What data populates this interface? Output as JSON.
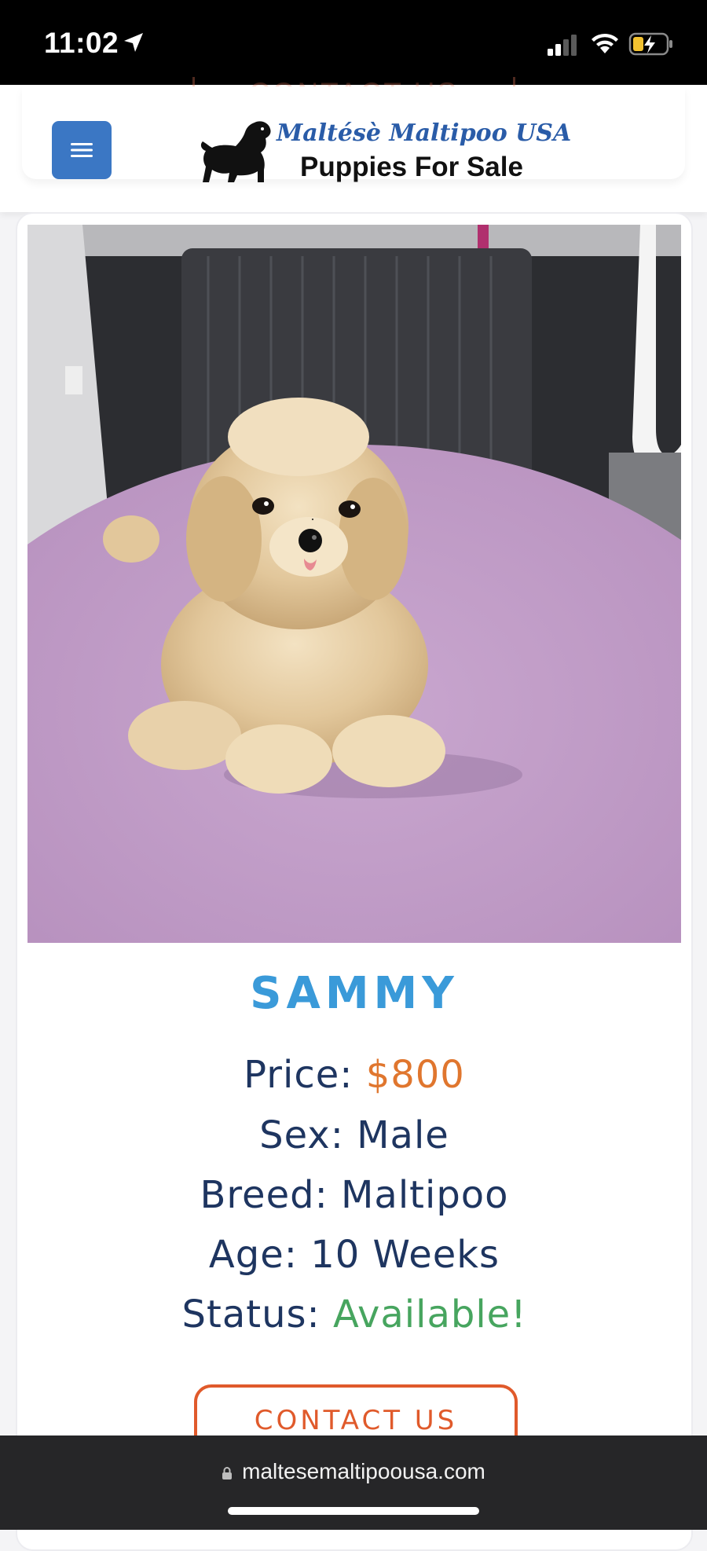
{
  "status_bar": {
    "time": "11:02",
    "icons": [
      "location-arrow-icon",
      "cellular-signal-icon",
      "wifi-icon",
      "battery-charging-icon"
    ]
  },
  "header": {
    "ghost_contact_label": "CONTACT US",
    "menu_icon": "hamburger-menu-icon",
    "logo_title": "Maltésè Maltipoo USA",
    "logo_subtitle": "Puppies For Sale"
  },
  "puppy": {
    "photo": "fluffy apricot maltipoo puppy on purple table",
    "name": "SAMMY",
    "price_label": "Price:",
    "price_value": "$800",
    "sex_label": "Sex:",
    "sex_value": "Male",
    "breed_label": "Breed:",
    "breed_value": "Maltipoo",
    "age_label": "Age:",
    "age_value": "10 Weeks",
    "status_label": "Status:",
    "status_value": "Available!",
    "contact_label": "CONTACT US"
  },
  "browser": {
    "url": "maltesemaltipoousa.com"
  },
  "colors": {
    "accent_blue": "#3a9ad9",
    "menu_blue": "#3b77c4",
    "price_orange": "#e0762e",
    "status_green": "#47a55f",
    "text_navy": "#1e3560",
    "button_orange": "#e05a2b"
  }
}
